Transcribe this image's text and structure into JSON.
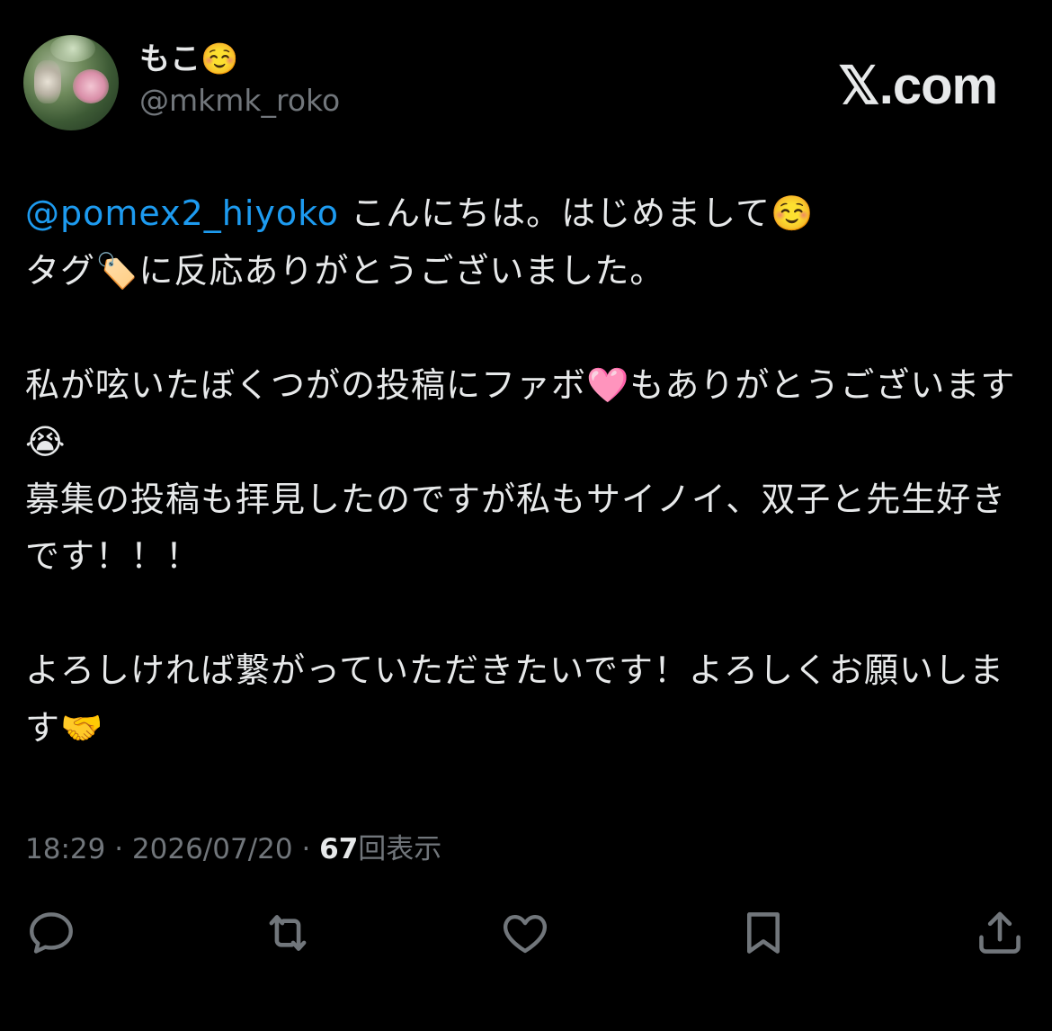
{
  "author": {
    "display_name": "もこ☺️",
    "handle": "@mkmk_roko"
  },
  "brand": "𝕏.com",
  "tweet": {
    "mention": "@pomex2_hiyoko",
    "line1_rest": " こんにちは。はじめまして☺️",
    "line2": "タグ🏷️に反応ありがとうございました。",
    "para2": "私が呟いたぼくつがの投稿にファボ🩷もありがとうございます😭",
    "para3": "募集の投稿も拝見したのですが私もサイノイ、双子と先生好きです！！！",
    "para4": "よろしければ繋がっていただきたいです！よろしくお願いします🤝"
  },
  "meta": {
    "time": "18:29",
    "separator": " · ",
    "date": "2026/07/20",
    "views_count": "67",
    "views_label": "回表示"
  },
  "actions": [
    {
      "name": "reply",
      "icon": "speech-bubble-icon"
    },
    {
      "name": "repost",
      "icon": "repost-arrows-icon"
    },
    {
      "name": "like",
      "icon": "heart-icon"
    },
    {
      "name": "bookmark",
      "icon": "bookmark-icon"
    },
    {
      "name": "share",
      "icon": "share-upload-icon"
    }
  ],
  "colors": {
    "background": "#000000",
    "text": "#e7e9ea",
    "secondary": "#71767b",
    "mention": "#1d9bf0"
  }
}
